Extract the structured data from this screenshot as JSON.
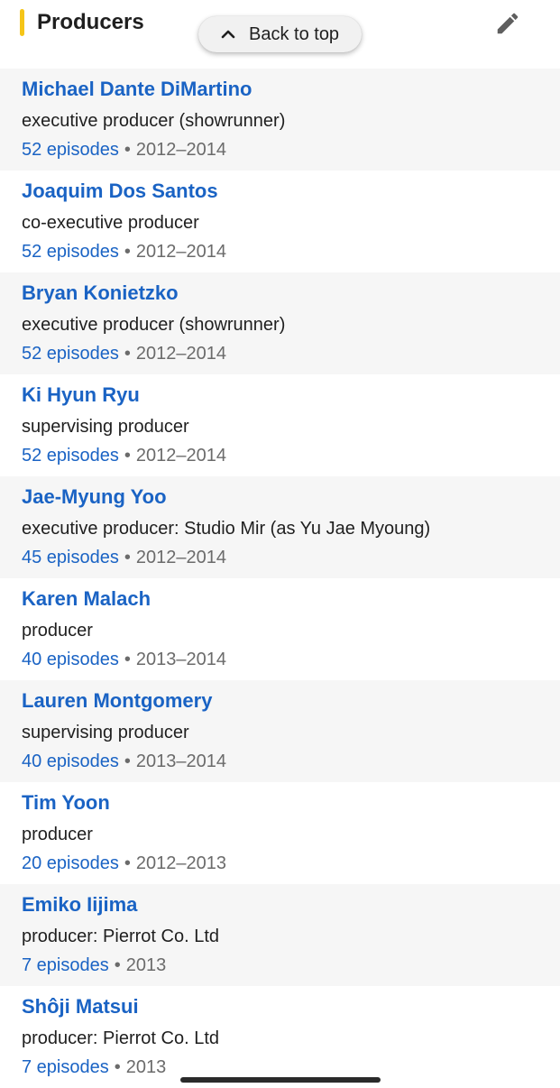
{
  "section": {
    "title": "Producers",
    "accent_color": "#f5c518",
    "edit_icon": "pencil-icon"
  },
  "back_to_top": {
    "label": "Back to top",
    "icon": "chevron-up-icon"
  },
  "colors": {
    "link": "#1a63c4",
    "muted": "#6b6b6b",
    "row_shade": "#f6f6f6"
  },
  "producers": [
    {
      "name": "Michael Dante DiMartino",
      "role": "executive producer (showrunner)",
      "episodes": "52 episodes",
      "separator": "•",
      "years": "2012–2014"
    },
    {
      "name": "Joaquim Dos Santos",
      "role": "co-executive producer",
      "episodes": "52 episodes",
      "separator": "•",
      "years": "2012–2014"
    },
    {
      "name": "Bryan Konietzko",
      "role": "executive producer (showrunner)",
      "episodes": "52 episodes",
      "separator": "•",
      "years": "2012–2014"
    },
    {
      "name": "Ki Hyun Ryu",
      "role": "supervising producer",
      "episodes": "52 episodes",
      "separator": "•",
      "years": "2012–2014"
    },
    {
      "name": "Jae-Myung Yoo",
      "role": "executive producer: Studio Mir (as Yu Jae Myoung)",
      "episodes": "45 episodes",
      "separator": "•",
      "years": "2012–2014"
    },
    {
      "name": "Karen Malach",
      "role": "producer",
      "episodes": "40 episodes",
      "separator": "•",
      "years": "2013–2014"
    },
    {
      "name": "Lauren Montgomery",
      "role": "supervising producer",
      "episodes": "40 episodes",
      "separator": "•",
      "years": "2013–2014"
    },
    {
      "name": "Tim Yoon",
      "role": "producer",
      "episodes": "20 episodes",
      "separator": "•",
      "years": "2012–2013"
    },
    {
      "name": "Emiko Iijima",
      "role": "producer: Pierrot Co. Ltd",
      "episodes": "7 episodes",
      "separator": "•",
      "years": "2013"
    },
    {
      "name": "Shôji Matsui",
      "role": "producer: Pierrot Co. Ltd",
      "episodes": "7 episodes",
      "separator": "•",
      "years": "2013"
    }
  ]
}
